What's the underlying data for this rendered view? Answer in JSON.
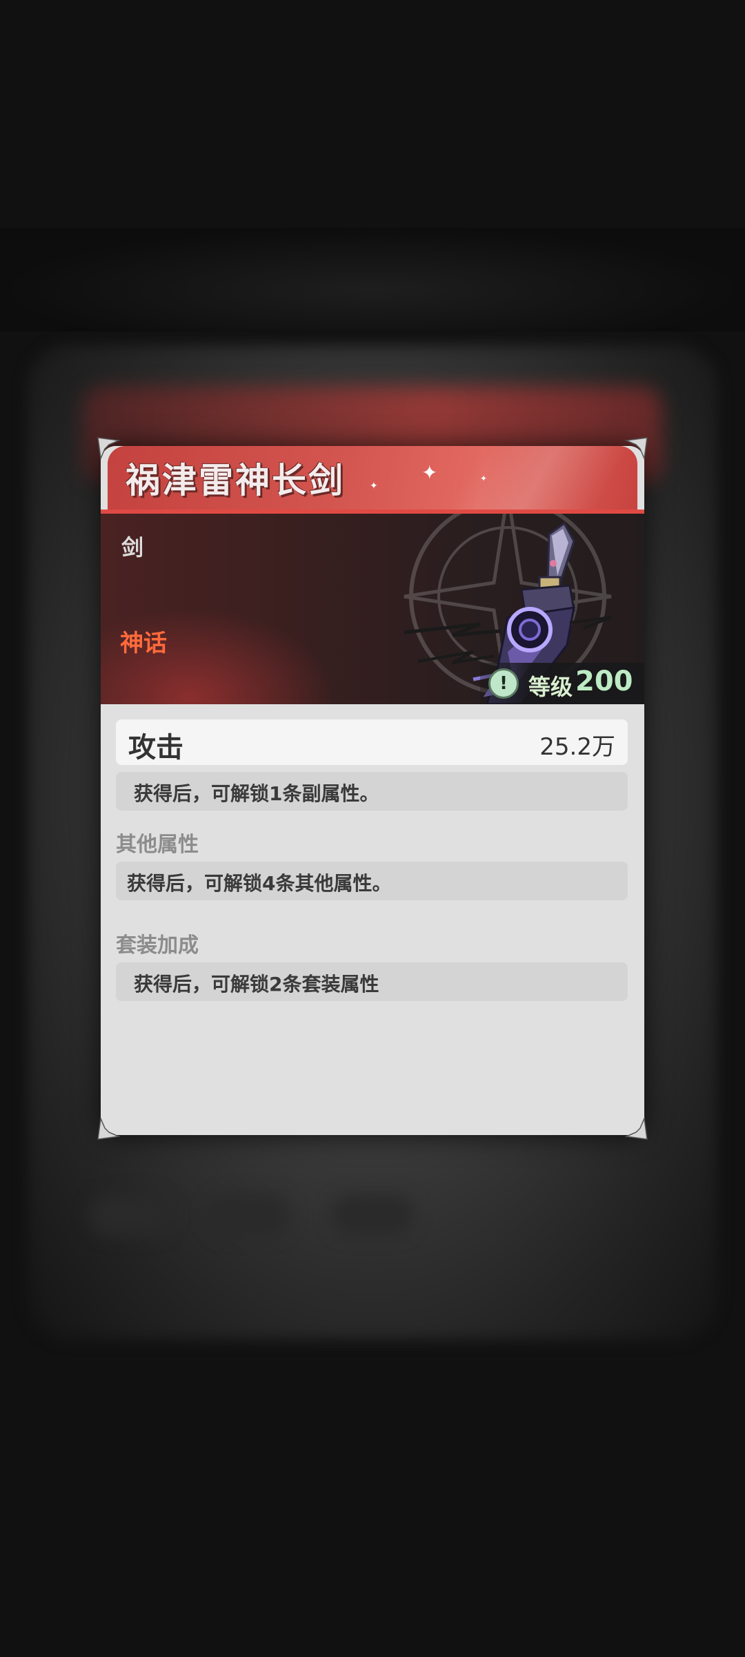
{
  "item": {
    "name": "祸津雷神长剑",
    "type": "剑",
    "rarity": "神话",
    "rarity_color": "#ff6a3c",
    "level_label": "等级",
    "level_value": "200"
  },
  "stats": {
    "main": {
      "name": "攻击",
      "value": "25.2万"
    },
    "sub_unlock": "获得后，可解锁1条副属性。"
  },
  "sections": {
    "other": {
      "title": "其他属性",
      "text": "获得后，可解锁4条其他属性。"
    },
    "set": {
      "title": "套装加成",
      "text": "获得后，可解锁2条套装属性"
    }
  },
  "icons": {
    "level": "alert-circle-icon",
    "corner": "corner-ornament-icon",
    "weapon": "sword-icon"
  },
  "colors": {
    "title_red": "#d45650",
    "level_green": "#bdebc4",
    "panel_bg": "#e0e0e0"
  }
}
